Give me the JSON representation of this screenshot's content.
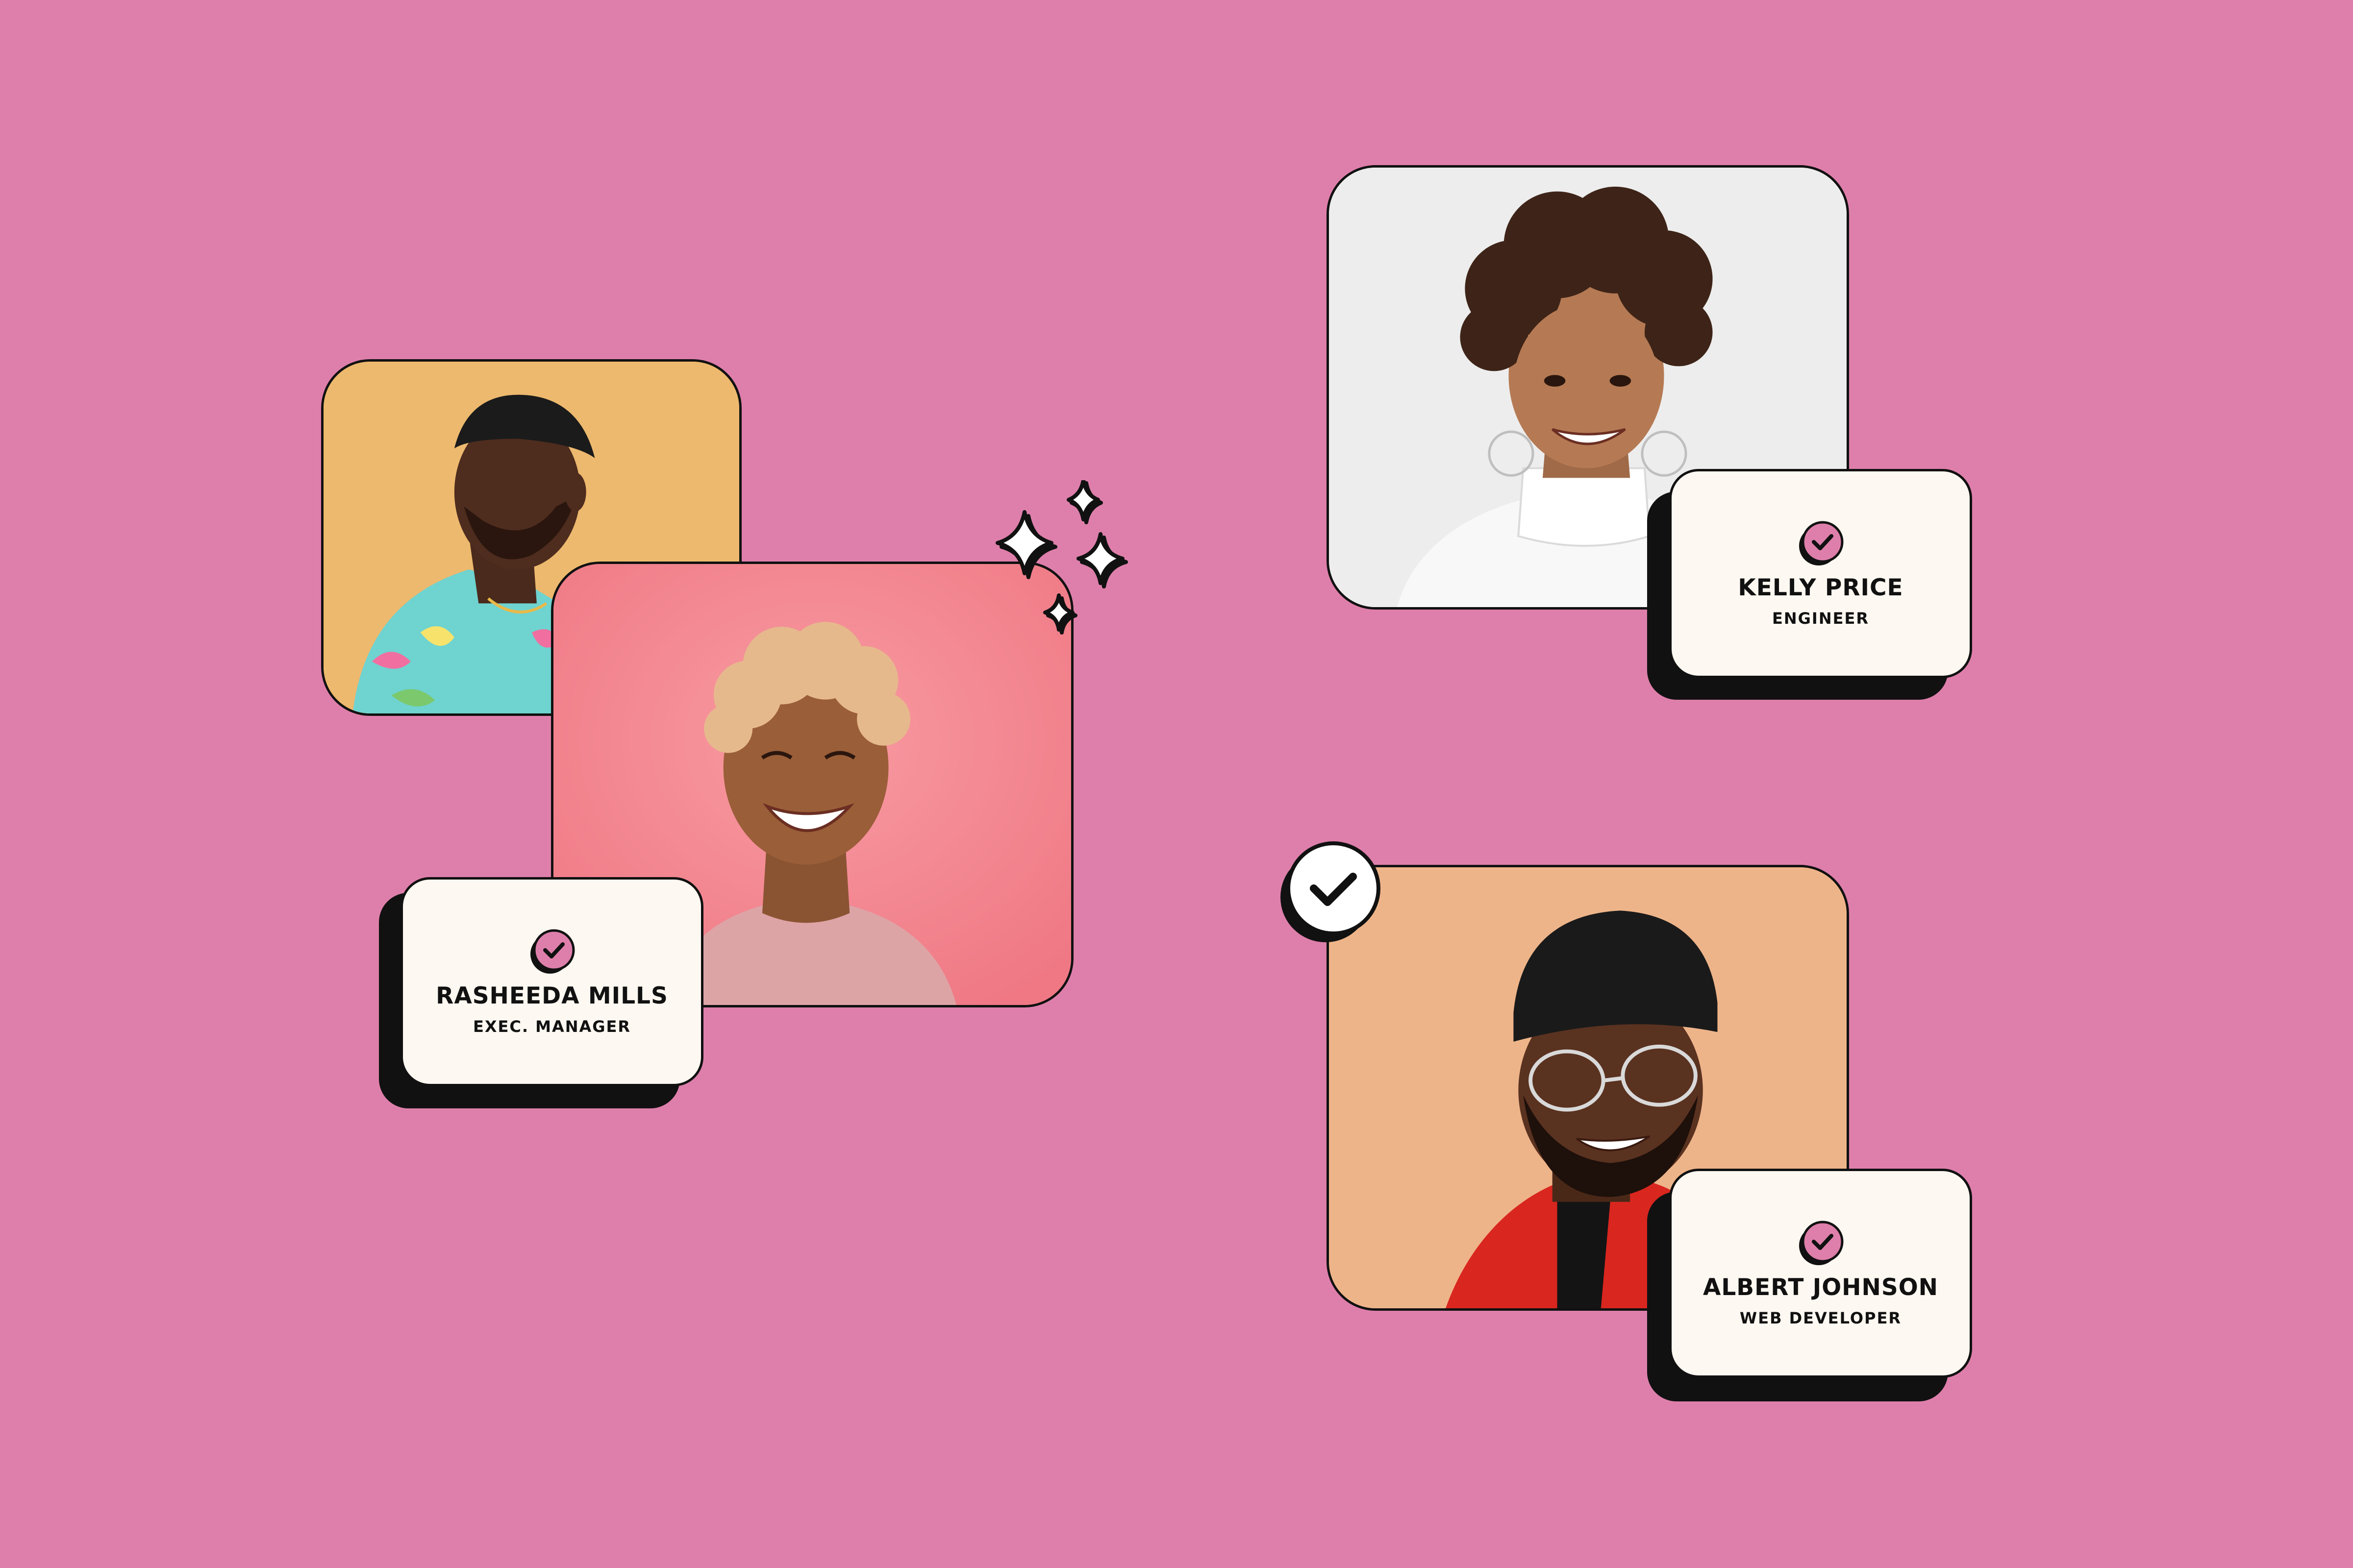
{
  "colors": {
    "background": "#DE7FAB",
    "card": "#FDF8F1",
    "outline": "#111111",
    "badge_pink": "#DE7FAB"
  },
  "profiles": [
    {
      "photo": "man-in-floral-shirt-on-yellow",
      "card": null
    },
    {
      "photo": "smiling-woman-on-pink",
      "card": {
        "name": "RASHEEDA MILLS",
        "role": "EXEC. MANAGER",
        "icon": "check-badge-icon"
      }
    },
    {
      "photo": "smiling-woman-on-white",
      "card": {
        "name": "KELLY PRICE",
        "role": "ENGINEER",
        "icon": "check-badge-icon"
      }
    },
    {
      "photo": "man-in-beanie-on-peach",
      "card": {
        "name": "ALBERT JOHNSON",
        "role": "WEB DEVELOPER",
        "icon": "check-badge-icon"
      }
    }
  ],
  "decorations": {
    "floating_check_icon": "check-circle-icon",
    "sparkles_icon": "sparkles-icon"
  }
}
